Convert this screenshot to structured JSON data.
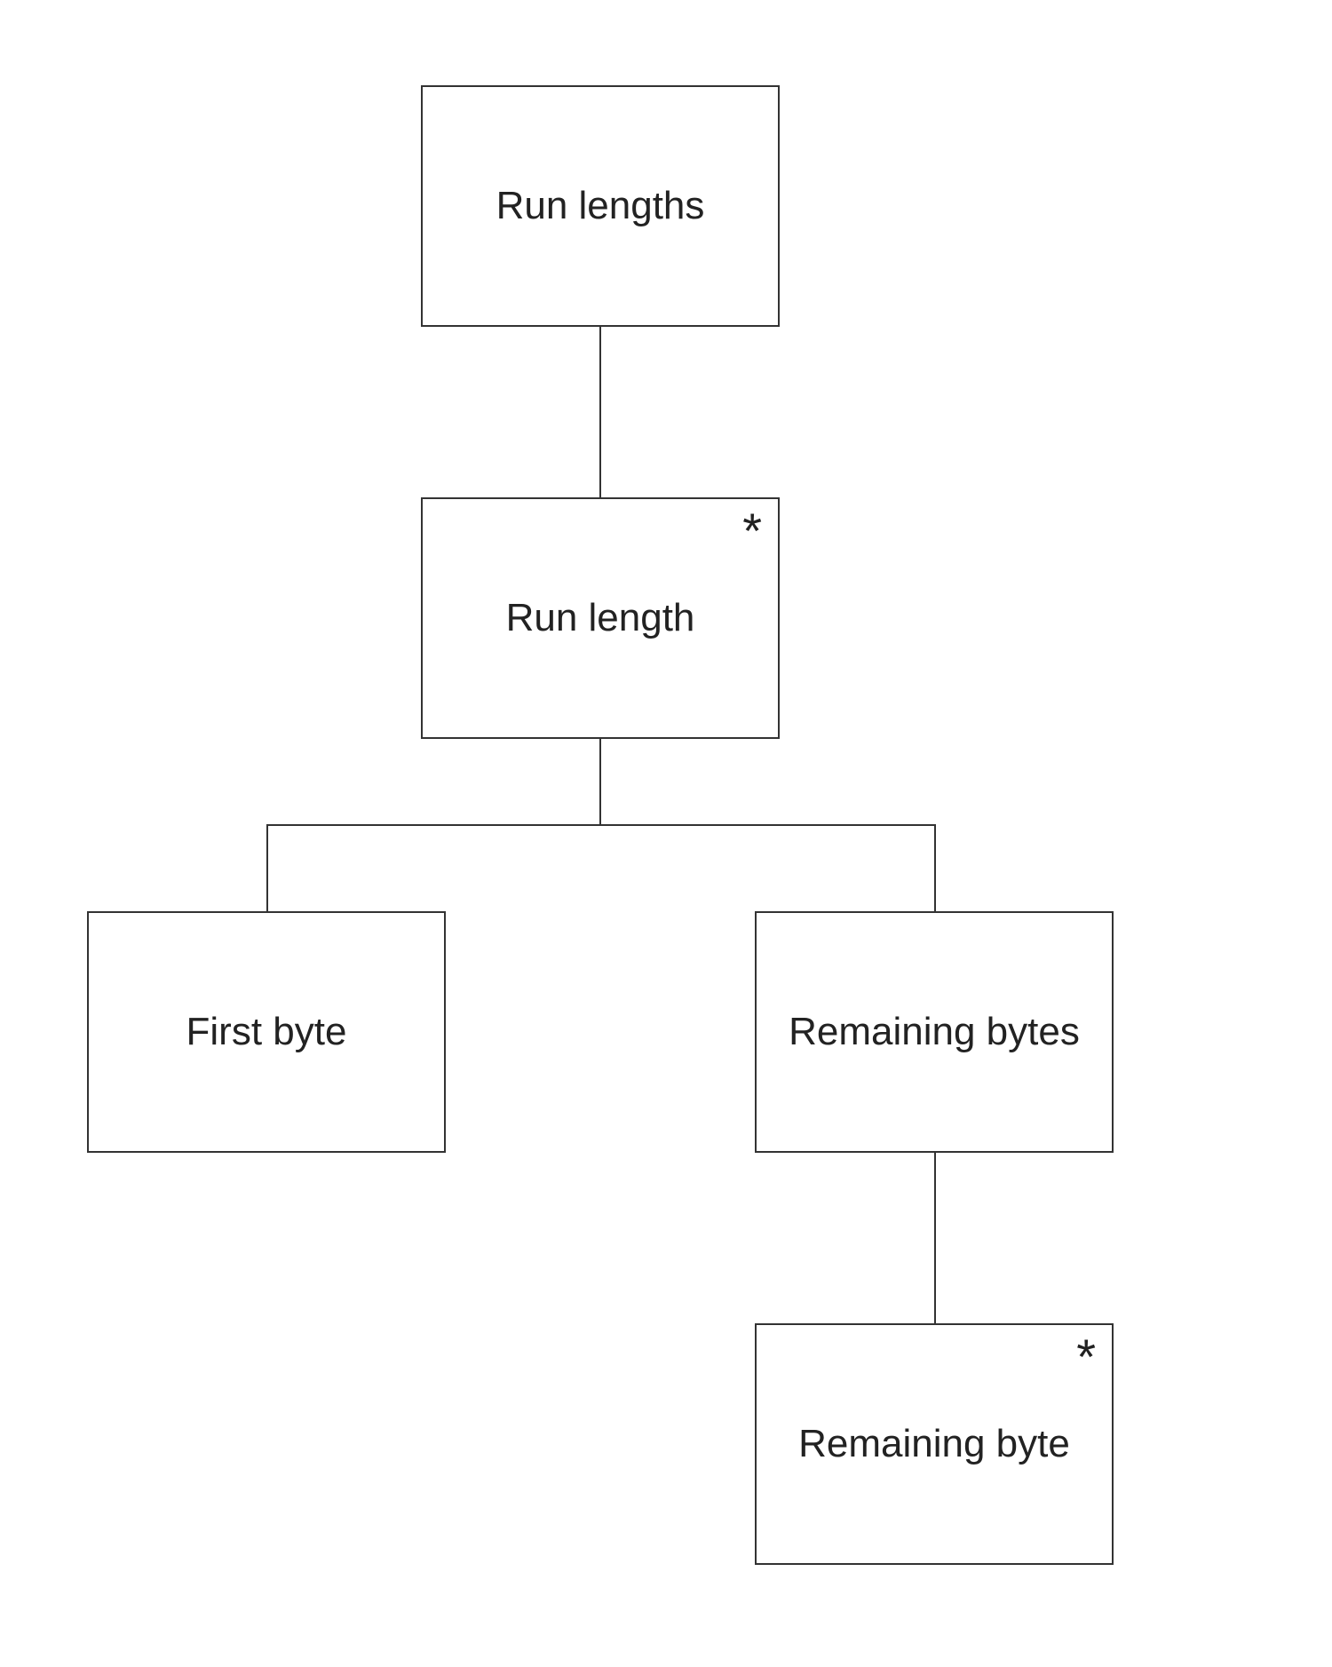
{
  "diagram": {
    "nodes": {
      "run_lengths": {
        "label": "Run lengths",
        "annotation": ""
      },
      "run_length": {
        "label": "Run length",
        "annotation": "*"
      },
      "first_byte": {
        "label": "First byte",
        "annotation": ""
      },
      "remaining_bytes": {
        "label": "Remaining bytes",
        "annotation": ""
      },
      "remaining_byte": {
        "label": "Remaining byte",
        "annotation": "*"
      }
    }
  }
}
